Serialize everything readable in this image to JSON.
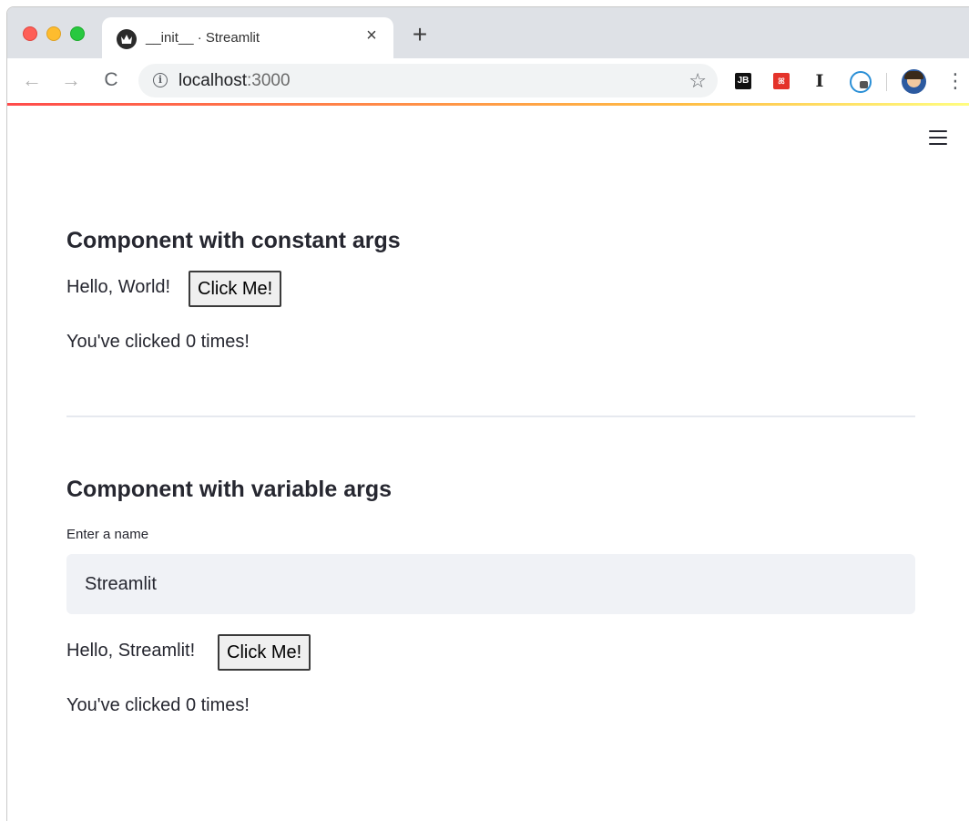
{
  "browser": {
    "tab_title": "__init__ · Streamlit",
    "tab_close": "×",
    "new_tab": "+",
    "url_host": "localhost",
    "url_port": ":3000",
    "nav": {
      "back": "←",
      "forward": "→",
      "reload": "C"
    },
    "star": "☆",
    "kebab": "⋮",
    "extensions": [
      {
        "name": "jetbrains-icon",
        "label": "JB"
      },
      {
        "name": "kitten-icon",
        "label": "ꕤ"
      },
      {
        "name": "ifont-icon",
        "label": "I"
      },
      {
        "name": "tracker-icon",
        "label": ""
      }
    ],
    "accent_gradient": [
      "#ff4b4b",
      "#ffbd45",
      "#fffd80"
    ]
  },
  "page": {
    "section1": {
      "heading": "Component with constant args",
      "greeting": "Hello, World!",
      "button_label": "Click Me!",
      "clicked_text": "You've clicked 0 times!"
    },
    "section2": {
      "heading": "Component with variable args",
      "input_label": "Enter a name",
      "input_value": "Streamlit",
      "greeting": "Hello, Streamlit!",
      "button_label": "Click Me!",
      "clicked_text": "You've clicked 0 times!"
    }
  },
  "colors": {
    "text": "#262730",
    "input_bg": "#f0f2f6",
    "divider": "#e6e9ef"
  }
}
